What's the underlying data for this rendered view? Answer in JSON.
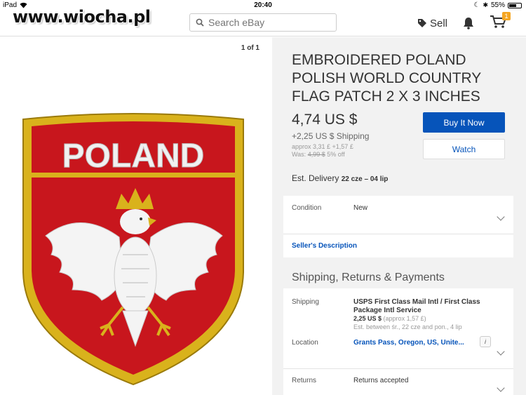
{
  "status_bar": {
    "device": "iPad",
    "time": "20:40",
    "battery": "55%"
  },
  "watermark": "www.wiocha.pl",
  "search": {
    "placeholder": "Search eBay"
  },
  "header": {
    "sell_label": "Sell",
    "cart_count": "1"
  },
  "gallery": {
    "counter": "1 of 1",
    "patch_text": "POLAND"
  },
  "listing": {
    "title": "EMBROIDERED POLAND POLISH WORLD COUNTRY FLAG PATCH 2 X 3 INCHES",
    "price": "4,74 US $",
    "shipping": "+2,25 US $ Shipping",
    "approx": "approx 3,31 £ +1,57 £",
    "was_label": "Was:",
    "was_price": "4,99 $",
    "discount": "5% off",
    "buy_now_label": "Buy It Now",
    "watch_label": "Watch",
    "delivery_label": "Est. Delivery",
    "delivery_dates": "22 cze – 04 lip"
  },
  "details": {
    "condition_label": "Condition",
    "condition_value": "New",
    "seller_description": "Seller's Description"
  },
  "shipping_section": {
    "heading": "Shipping, Returns & Payments",
    "shipping_label": "Shipping",
    "shipping_method": "USPS First Class Mail Intl / First Class Package Intl Service",
    "shipping_cost": "2,25 US $",
    "shipping_cost_approx": "(approx 1,57 £)",
    "shipping_estimate": "Est. between śr., 22 cze and pon., 4 lip",
    "location_label": "Location",
    "location_value": "Grants Pass, Oregon, US, Unite...",
    "info_icon": "i",
    "returns_label": "Returns",
    "returns_value": "Returns accepted"
  },
  "colors": {
    "ebay_blue": "#0654ba",
    "patch_red": "#c8161d",
    "patch_gold": "#d9b21c",
    "cart_badge": "#f5a623"
  }
}
